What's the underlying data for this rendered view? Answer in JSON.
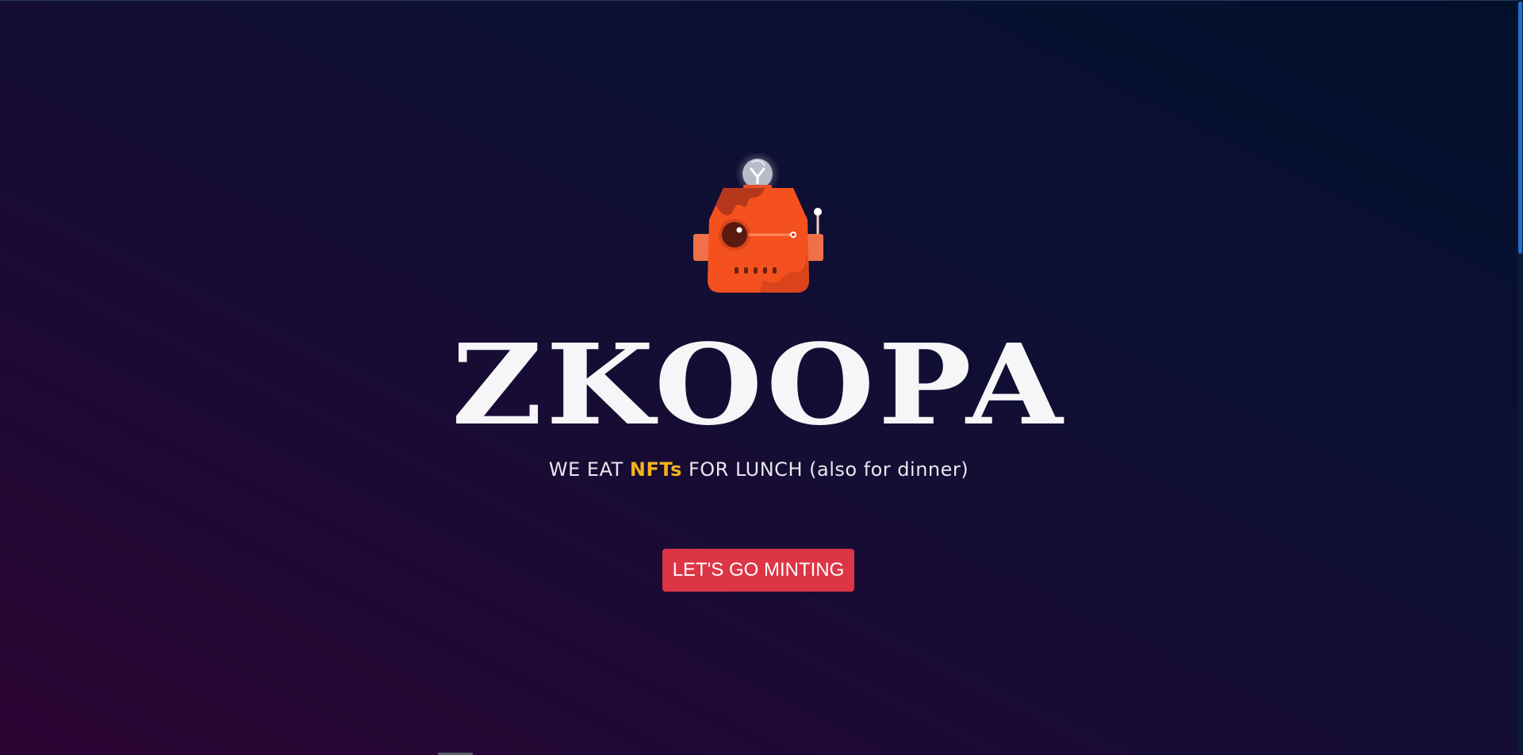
{
  "hero": {
    "brand": "ZKOOPA",
    "tagline_prefix": "WE EAT ",
    "tagline_highlight": "NFTs",
    "tagline_suffix": " FOR LUNCH (also for dinner)",
    "cta_label": "LET'S GO MINTING"
  },
  "mascot": {
    "icon": "robot-mascot-icon"
  },
  "colors": {
    "background_top_right": "#03102c",
    "background_bottom_left": "#2c0434",
    "highlight": "#f3b21b",
    "cta": "#dc3545",
    "robot_body": "#f4511e",
    "scrollbar_thumb": "#1e6fd0"
  }
}
